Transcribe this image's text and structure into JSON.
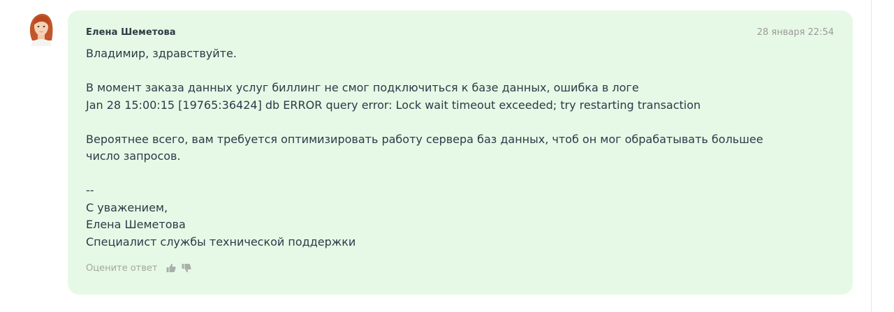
{
  "message": {
    "author": "Елена Шеметова",
    "timestamp": "28 января 22:54",
    "lines": {
      "greeting": "Владимир, здравствуйте.",
      "p1_l1": "В момент заказа данных услуг биллинг не смог подключиться к базе данных, ошибка в логе",
      "p1_l2": "Jan 28 15:00:15 [19765:36424] db ERROR query error: Lock wait timeout exceeded; try restarting transaction",
      "p2_l1": "Вероятнее всего, вам требуется оптимизировать работу сервера баз данных, чтоб он мог обрабатывать большее",
      "p2_l2": "число запросов.",
      "sig_sep": "--",
      "sig_regards": "С уважением,",
      "sig_name": "Елена Шеметова",
      "sig_role": "Специалист службы технической поддержки"
    }
  },
  "rating": {
    "label": "Оцените ответ",
    "up_icon": "thumbs-up-icon",
    "down_icon": "thumbs-down-icon"
  },
  "colors": {
    "bubble_bg": "#e6f9e6",
    "text": "#2a3a48",
    "muted": "#9a9a9a"
  }
}
